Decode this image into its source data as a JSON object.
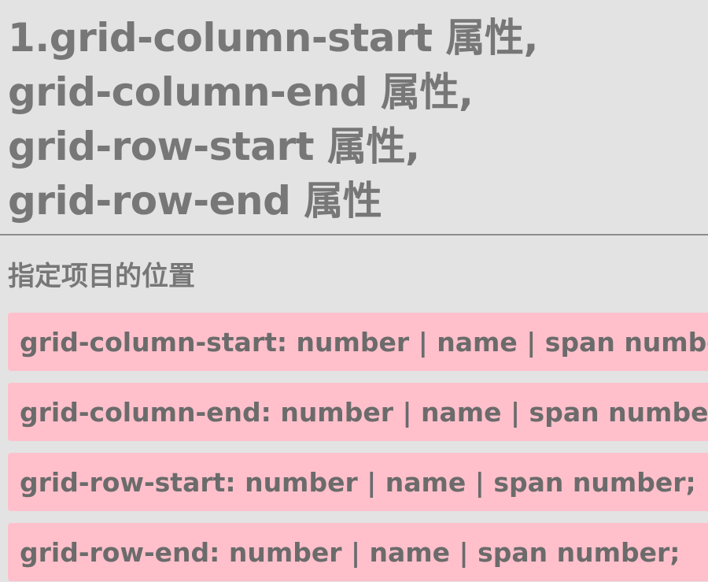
{
  "title": {
    "lines": [
      "1.grid-column-start 属性,",
      "grid-column-end 属性,",
      "grid-row-start 属性,",
      "grid-row-end 属性"
    ]
  },
  "subtitle": "指定项目的位置",
  "code_items": [
    "grid-column-start: number | name | span number;",
    "grid-column-end: number | name | span number;",
    "grid-row-start: number | name | span number;",
    "grid-row-end: number | name | span number;"
  ],
  "colors": {
    "background": "#e3e3e3",
    "text": "#777777",
    "code_background": "#ffc0cb"
  }
}
